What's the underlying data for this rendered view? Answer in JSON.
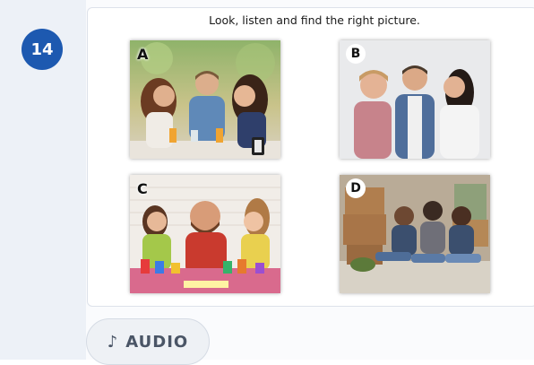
{
  "question": {
    "number": "14"
  },
  "instruction": "Look, listen and find the right picture.",
  "pictures": [
    {
      "letter": "A",
      "scene": "three friends arguing at a café table"
    },
    {
      "letter": "B",
      "scene": "man standing between two arguing women"
    },
    {
      "letter": "C",
      "scene": "father painting with two children"
    },
    {
      "letter": "D",
      "scene": "three sad people sitting on floor among boxes"
    }
  ],
  "audio_button": {
    "icon": "music-note-icon",
    "label": "AUDIO"
  },
  "colors": {
    "accent": "#1d59b0",
    "rail": "#edf1f7"
  }
}
